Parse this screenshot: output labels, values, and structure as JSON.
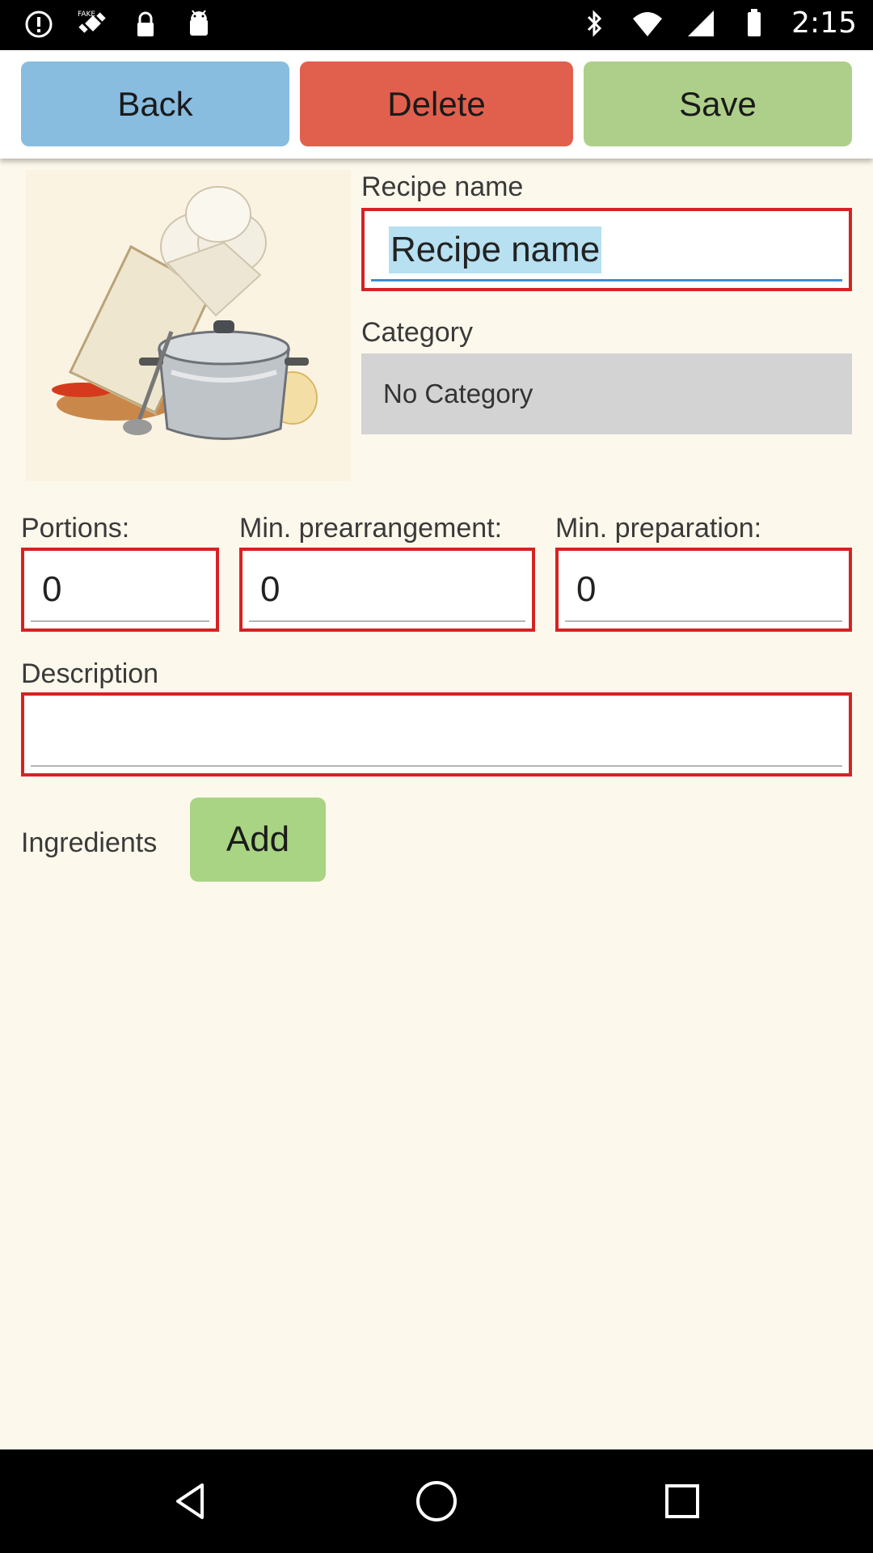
{
  "status_bar": {
    "time": "2:15",
    "left_icons": [
      "alert-circle-icon",
      "fake-gps-icon",
      "lock-icon",
      "android-icon"
    ],
    "right_icons": [
      "bluetooth-icon",
      "wifi-icon",
      "signal-icon",
      "battery-icon"
    ]
  },
  "toolbar": {
    "back_label": "Back",
    "delete_label": "Delete",
    "save_label": "Save"
  },
  "recipe_image_icon": "chef-hat-cookbook-pot-icon",
  "form": {
    "recipe_name_label": "Recipe name",
    "recipe_name_value": "Recipe name",
    "category_label": "Category",
    "category_value": "No Category",
    "portions_label": "Portions:",
    "portions_value": "0",
    "prearrangement_label": "Min. prearrangement:",
    "prearrangement_value": "0",
    "preparation_label": "Min. preparation:",
    "preparation_value": "0",
    "description_label": "Description",
    "description_value": "",
    "ingredients_label": "Ingredients",
    "add_label": "Add"
  },
  "nav_bar": {
    "icons": [
      "back-triangle-icon",
      "home-circle-icon",
      "recents-square-icon"
    ]
  }
}
